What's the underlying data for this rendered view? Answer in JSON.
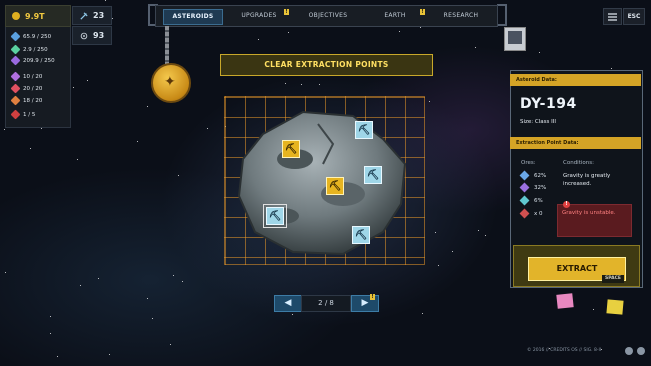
{
  "colors": {
    "accent_gold": "#e2b42a",
    "tab_active": "#1f3a52",
    "warning": "#ff8080",
    "grid": "#e6962a"
  },
  "resources": {
    "money": "9.9T",
    "items": [
      {
        "icon": "blue-crystal-icon",
        "value": "65.9 / 250",
        "color": "#5aa0e0"
      },
      {
        "icon": "green-crystal-icon",
        "value": "2.9 / 250",
        "color": "#5ad0a0"
      },
      {
        "icon": "purple-crystal-icon",
        "value": "209.9 / 250",
        "color": "#9a6ae0"
      },
      {
        "icon": "violet-gem-icon",
        "value": "10 / 20",
        "color": "#b070e0"
      },
      {
        "icon": "red-gem-icon",
        "value": "20 / 20",
        "color": "#e05060"
      },
      {
        "icon": "orange-gem-icon",
        "value": "18 / 20",
        "color": "#e08040"
      },
      {
        "icon": "red-alien-icon",
        "value": "1 / 5",
        "color": "#d04040"
      }
    ],
    "count_a": "23",
    "count_b": "93"
  },
  "nav": {
    "tabs": [
      "ASTEROIDS",
      "UPGRADES",
      "OBJECTIVES",
      "EARTH",
      "RESEARCH"
    ],
    "active": "ASTEROIDS",
    "badge": "!"
  },
  "top_right": {
    "menu_icon": "hamburger-menu-icon",
    "esc_label": "ESC"
  },
  "banner": "CLEAR EXTRACTION POINTS",
  "pager": {
    "prev_icon": "arrow-left-icon",
    "next_icon": "arrow-right-icon",
    "page": "2 / 8",
    "badge": "!"
  },
  "panel": {
    "asteroid_header": "Asteroid Data:",
    "name": "DY-194",
    "size_label": "Size:",
    "size_value": "Class III",
    "extraction_header": "Extraction Point Data:",
    "ores_label": "Ores:",
    "conditions_label": "Conditions:",
    "ores": [
      {
        "icon": "blue-ore-icon",
        "value": "62%",
        "color": "#6aa8e8"
      },
      {
        "icon": "purple-ore-icon",
        "value": "32%",
        "color": "#9a70e0"
      },
      {
        "icon": "teal-ore-icon",
        "value": "6%",
        "color": "#60c8d0"
      },
      {
        "icon": "alien-ore-icon",
        "value": "x 0",
        "color": "#d05050"
      }
    ],
    "condition_text": "Gravity is greatly increased.",
    "warning_badge": "!",
    "warning_text": "Gravity is unstable.",
    "extract_label": "EXTRACT",
    "extract_key": "SPACE"
  },
  "footer": "© 2016 // CREDITS OS // SIG. 8-II"
}
